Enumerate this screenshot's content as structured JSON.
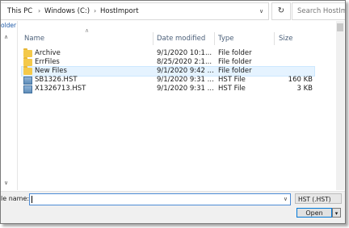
{
  "address_bar": {
    "crumbs": [
      "This PC",
      "Windows (C:)",
      "HostImport"
    ]
  },
  "search": {
    "placeholder": "Search HostIm"
  },
  "nav_pane": {
    "label": "older"
  },
  "columns": [
    "Name",
    "Date modified",
    "Type",
    "Size"
  ],
  "files": [
    {
      "name": "Archive",
      "date": "9/1/2020 10:1...",
      "type": "File folder",
      "size": "",
      "icon": "folder-icon"
    },
    {
      "name": "ErrFiles",
      "date": "8/25/2020 2:1...",
      "type": "File folder",
      "size": "",
      "icon": "folder-icon"
    },
    {
      "name": "New Files",
      "date": "9/1/2020 9:42 ...",
      "type": "File folder",
      "size": "",
      "icon": "folder-icon"
    },
    {
      "name": "SB1326.HST",
      "date": "9/1/2020 9:31 ...",
      "type": "HST File",
      "size": "160 KB",
      "icon": "file-icon"
    },
    {
      "name": "X1326713.HST",
      "date": "9/1/2020 9:31 ...",
      "type": "HST File",
      "size": "3 KB",
      "icon": "file-icon"
    }
  ],
  "bottom": {
    "filename_label": "le name:",
    "filename_value": "",
    "filter": "HST (.HST)",
    "open_label": "Open"
  },
  "colors": {
    "selection": "#e5f3ff",
    "accent": "#0078d7",
    "folder": "#f4c94a"
  }
}
